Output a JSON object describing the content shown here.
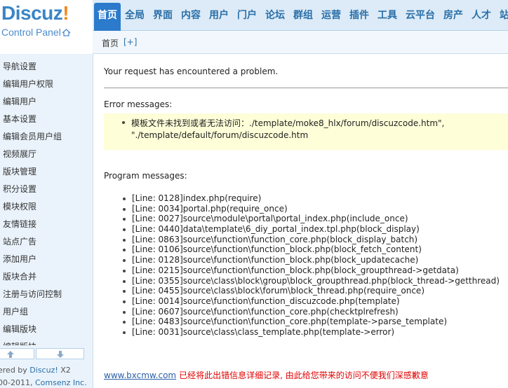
{
  "logo": {
    "brand": "Discuz",
    "bang": "!",
    "subtitle": "Control Panel",
    "home_icon": "home-icon"
  },
  "topnav": {
    "tabs": [
      {
        "label": "首页",
        "active": true
      },
      {
        "label": "全局"
      },
      {
        "label": "界面"
      },
      {
        "label": "内容"
      },
      {
        "label": "用户"
      },
      {
        "label": "门户"
      },
      {
        "label": "论坛"
      },
      {
        "label": "群组"
      },
      {
        "label": "运营"
      },
      {
        "label": "插件"
      },
      {
        "label": "工具"
      },
      {
        "label": "云平台"
      },
      {
        "label": "房产"
      },
      {
        "label": "人才"
      },
      {
        "label": "站"
      }
    ]
  },
  "subbar": {
    "breadcrumb": "首页",
    "add_label": "[+]"
  },
  "sidebar": {
    "items": [
      "导航设置",
      "编辑用户权限",
      "编辑用户",
      "基本设置",
      "编辑会员用户组",
      "视频展厅",
      "版块管理",
      "积分设置",
      "模块权限",
      "友情链接",
      "站点广告",
      "添加用户",
      "版块合并",
      "注册与访问控制",
      "用户组",
      "编辑版块",
      "编辑版块"
    ],
    "scroll_up_icon": "arrow-up-icon",
    "scroll_down_icon": "arrow-down-icon"
  },
  "footer_left": {
    "powered_prefix": "ered by ",
    "powered_link": "Discuz!",
    "powered_version": " X2",
    "copyright_prefix": "00-2011, ",
    "copyright_link": "Comsenz Inc."
  },
  "main": {
    "message": "Your request has encountered a problem.",
    "error_heading": "Error messages:",
    "error_line1": "模板文件未找到或者无法访问：./template/moke8_hlx/forum/discuzcode.htm\",",
    "error_line2": "\"./template/default/forum/discuzcode.htm",
    "program_heading": "Program messages:",
    "program_lines": [
      "[Line: 0128]index.php(require)",
      "[Line: 0034]portal.php(require_once)",
      "[Line: 0027]source\\module\\portal\\portal_index.php(include_once)",
      "[Line: 0440]data\\template\\6_diy_portal_index.tpl.php(block_display)",
      "[Line: 0863]source\\function\\function_core.php(block_display_batch)",
      "[Line: 0106]source\\function\\function_block.php(block_fetch_content)",
      "[Line: 0128]source\\function\\function_block.php(block_updatecache)",
      "[Line: 0215]source\\function\\function_block.php(block_groupthread->getdata)",
      "[Line: 0355]source\\class\\block\\group\\block_groupthread.php(block_thread->getthread)",
      "[Line: 0455]source\\class\\block\\forum\\block_thread.php(require_once)",
      "[Line: 0014]source\\function\\function_discuzcode.php(template)",
      "[Line: 0607]source\\function\\function_core.php(checktplrefresh)",
      "[Line: 0483]source\\function\\function_core.php(template->parse_template)",
      "[Line: 0031]source\\class\\class_template.php(template->error)"
    ],
    "site_link": "www.bxcmw.com",
    "apology": "已经将此出错信息详细记录, 由此给您带来的访问不便我们深感歉意"
  },
  "colors": {
    "brand_blue": "#3a85c6",
    "brand_orange": "#f2881c",
    "active_tab": "#2b7acb",
    "error_box": "#fefed8",
    "apology_red": "#e00000"
  }
}
